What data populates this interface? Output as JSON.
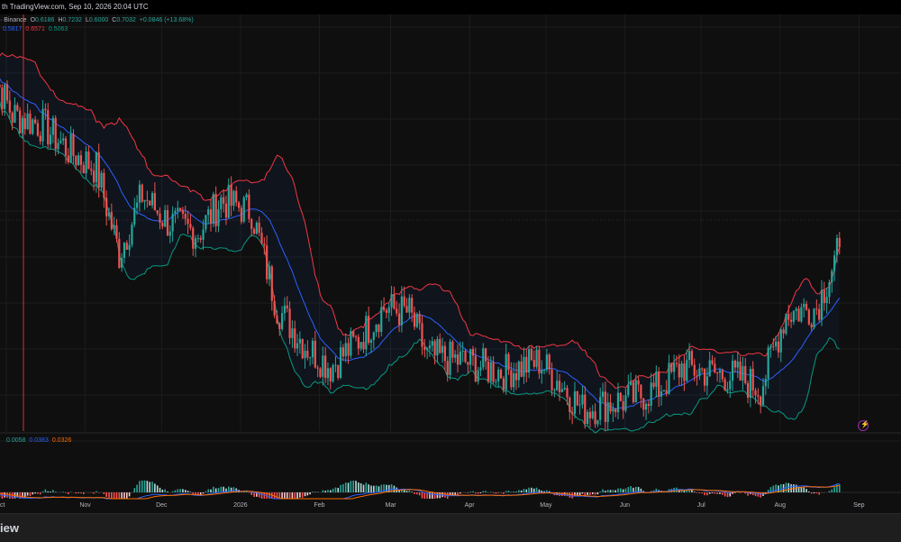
{
  "header": {
    "attribution": "th TradingView.com, Sep 10, 2026 20:04 UTC"
  },
  "legend_main": {
    "exchange": "· Binance",
    "open_label": "O",
    "open": "0.6186",
    "high_label": "H",
    "high": "0.7232",
    "low_label": "L",
    "low": "0.6000",
    "close_label": "C",
    "close": "0.7032",
    "change": "+0.0846 (+13.68%)"
  },
  "legend_bb": {
    "basis": "0.5817",
    "upper": "0.6571",
    "lower": "0.5063"
  },
  "legend_macd": {
    "hist": "0.0058",
    "macd": "0.0383",
    "signal": "0.0326"
  },
  "footer": {
    "brand": "iew"
  },
  "colors": {
    "up": "#26a69a",
    "down": "#ef5350",
    "basis": "#2962ff",
    "upper": "#f23645",
    "lower": "#089981",
    "macd": "#2962ff",
    "signal": "#ff6d00",
    "bolt": "#9c27b0"
  },
  "icons": {
    "alert": "lightning-icon"
  },
  "chart_data": [
    {
      "type": "candlestick",
      "title": "",
      "x_axis_labels": [
        "ct",
        "Nov",
        "Dec",
        "2026",
        "Feb",
        "Mar",
        "Apr",
        "May",
        "Jun",
        "Jul",
        "Aug",
        "Sep"
      ],
      "indicators": [
        "Bollinger Bands (basis, upper, lower)"
      ],
      "close_trajectory": [
        {
          "date": "2025-10-10",
          "close": 1.05
        },
        {
          "date": "2025-10-20",
          "close": 0.95
        },
        {
          "date": "2025-11-01",
          "close": 0.93
        },
        {
          "date": "2025-11-12",
          "close": 0.88
        },
        {
          "date": "2025-11-22",
          "close": 0.85
        },
        {
          "date": "2025-12-01",
          "close": 0.69
        },
        {
          "date": "2025-12-10",
          "close": 0.8
        },
        {
          "date": "2025-12-20",
          "close": 0.75
        },
        {
          "date": "2026-01-01",
          "close": 0.73
        },
        {
          "date": "2026-01-10",
          "close": 0.79
        },
        {
          "date": "2026-01-22",
          "close": 0.77
        },
        {
          "date": "2026-02-01",
          "close": 0.59
        },
        {
          "date": "2026-02-12",
          "close": 0.52
        },
        {
          "date": "2026-02-22",
          "close": 0.48
        },
        {
          "date": "2026-03-05",
          "close": 0.53
        },
        {
          "date": "2026-03-15",
          "close": 0.59
        },
        {
          "date": "2026-03-25",
          "close": 0.58
        },
        {
          "date": "2026-04-01",
          "close": 0.5
        },
        {
          "date": "2026-04-15",
          "close": 0.49
        },
        {
          "date": "2026-05-01",
          "close": 0.47
        },
        {
          "date": "2026-05-15",
          "close": 0.49
        },
        {
          "date": "2026-05-25",
          "close": 0.44
        },
        {
          "date": "2026-06-01",
          "close": 0.4
        },
        {
          "date": "2026-06-10",
          "close": 0.41
        },
        {
          "date": "2026-06-20",
          "close": 0.42
        },
        {
          "date": "2026-07-01",
          "close": 0.44
        },
        {
          "date": "2026-07-10",
          "close": 0.48
        },
        {
          "date": "2026-07-20",
          "close": 0.47
        },
        {
          "date": "2026-08-01",
          "close": 0.46
        },
        {
          "date": "2026-08-10",
          "close": 0.44
        },
        {
          "date": "2026-08-20",
          "close": 0.58
        },
        {
          "date": "2026-09-01",
          "close": 0.59
        },
        {
          "date": "2026-09-10",
          "close": 0.7
        }
      ],
      "bollinger": {
        "basis": 0.5817,
        "upper": 0.6571,
        "lower": 0.5063
      },
      "last": {
        "open": 0.6186,
        "high": 0.7232,
        "low": 0.6,
        "close": 0.7032,
        "change": 0.0846,
        "change_pct": 13.68
      }
    },
    {
      "type": "bar",
      "title": "",
      "indicator": "MACD",
      "values": {
        "histogram": 0.0058,
        "macd": 0.0383,
        "signal": 0.0326
      }
    }
  ]
}
